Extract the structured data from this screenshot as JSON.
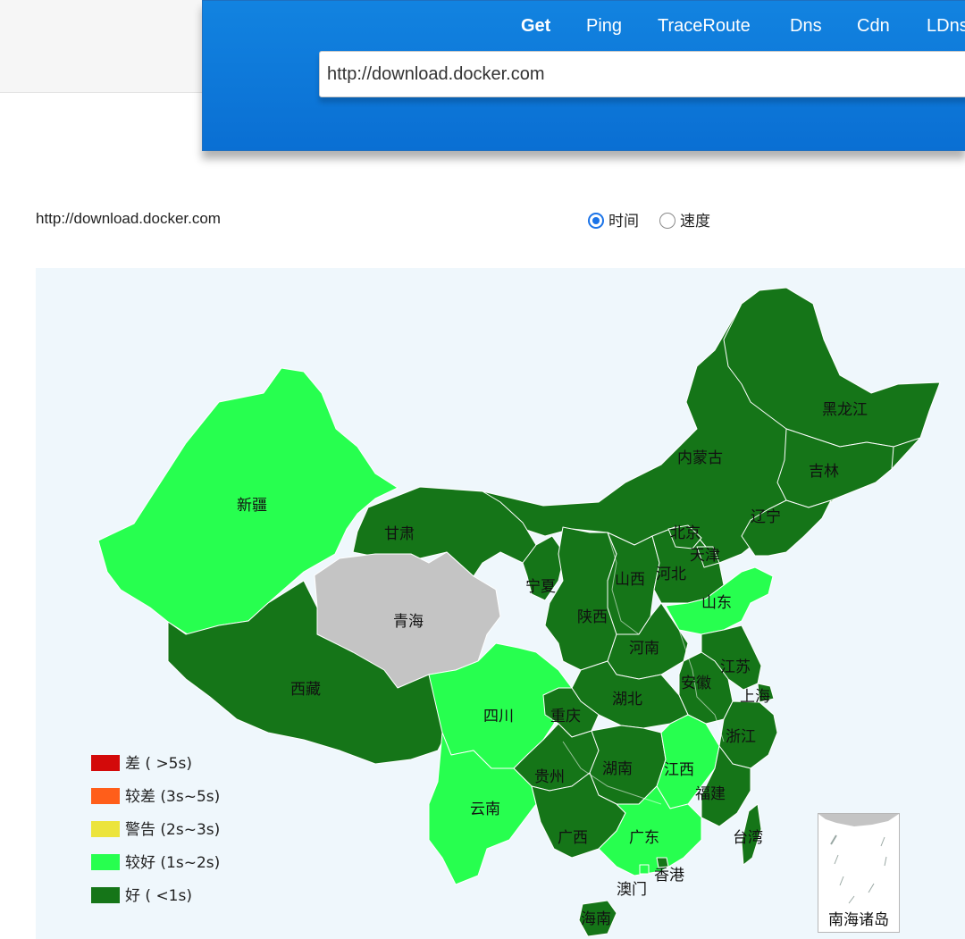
{
  "tabs": [
    {
      "label": "Get",
      "active": true
    },
    {
      "label": "Ping",
      "active": false
    },
    {
      "label": "TraceRoute",
      "active": false
    },
    {
      "label": "Dns",
      "active": false
    },
    {
      "label": "Cdn",
      "active": false
    },
    {
      "label": "LDns",
      "active": false
    }
  ],
  "url_input": {
    "value": "http://download.docker.com"
  },
  "result": {
    "url": "http://download.docker.com"
  },
  "mode": {
    "options": [
      {
        "label": "时间",
        "selected": true
      },
      {
        "label": "速度",
        "selected": false
      }
    ]
  },
  "legend": [
    {
      "label": "差 ( >5s)",
      "color": "#d30a0a"
    },
    {
      "label": "较差 (3s~5s)",
      "color": "#ff5e1a"
    },
    {
      "label": "警告 (2s~3s)",
      "color": "#ece43c"
    },
    {
      "label": "较好 (1s~2s)",
      "color": "#27ff4f"
    },
    {
      "label": "好 ( <1s)",
      "color": "#157518"
    }
  ],
  "status_colors": {
    "good": "#157518",
    "fair": "#27ff4f",
    "nodata": "#c4c4c4",
    "ocean": "#eff7fc"
  },
  "provinces": [
    {
      "name": "黑龙江",
      "status": "good"
    },
    {
      "name": "吉林",
      "status": "good"
    },
    {
      "name": "辽宁",
      "status": "good"
    },
    {
      "name": "内蒙古",
      "status": "good"
    },
    {
      "name": "北京",
      "status": "good"
    },
    {
      "name": "天津",
      "status": "good"
    },
    {
      "name": "河北",
      "status": "good"
    },
    {
      "name": "山西",
      "status": "good"
    },
    {
      "name": "山东",
      "status": "fair"
    },
    {
      "name": "新疆",
      "status": "fair"
    },
    {
      "name": "甘肃",
      "status": "good"
    },
    {
      "name": "青海",
      "status": "nodata"
    },
    {
      "name": "宁夏",
      "status": "good"
    },
    {
      "name": "陕西",
      "status": "good"
    },
    {
      "name": "河南",
      "status": "good"
    },
    {
      "name": "江苏",
      "status": "good"
    },
    {
      "name": "安徽",
      "status": "good"
    },
    {
      "name": "上海",
      "status": "good"
    },
    {
      "name": "西藏",
      "status": "good"
    },
    {
      "name": "四川",
      "status": "fair"
    },
    {
      "name": "重庆",
      "status": "good"
    },
    {
      "name": "湖北",
      "status": "good"
    },
    {
      "name": "浙江",
      "status": "good"
    },
    {
      "name": "贵州",
      "status": "good"
    },
    {
      "name": "湖南",
      "status": "good"
    },
    {
      "name": "江西",
      "status": "fair"
    },
    {
      "name": "福建",
      "status": "good"
    },
    {
      "name": "云南",
      "status": "fair"
    },
    {
      "name": "广西",
      "status": "good"
    },
    {
      "name": "广东",
      "status": "fair"
    },
    {
      "name": "台湾",
      "status": "good"
    },
    {
      "name": "香港",
      "status": "good"
    },
    {
      "name": "澳门",
      "status": "fair"
    },
    {
      "name": "海南",
      "status": "good"
    }
  ],
  "inset_label": "南海诸岛"
}
